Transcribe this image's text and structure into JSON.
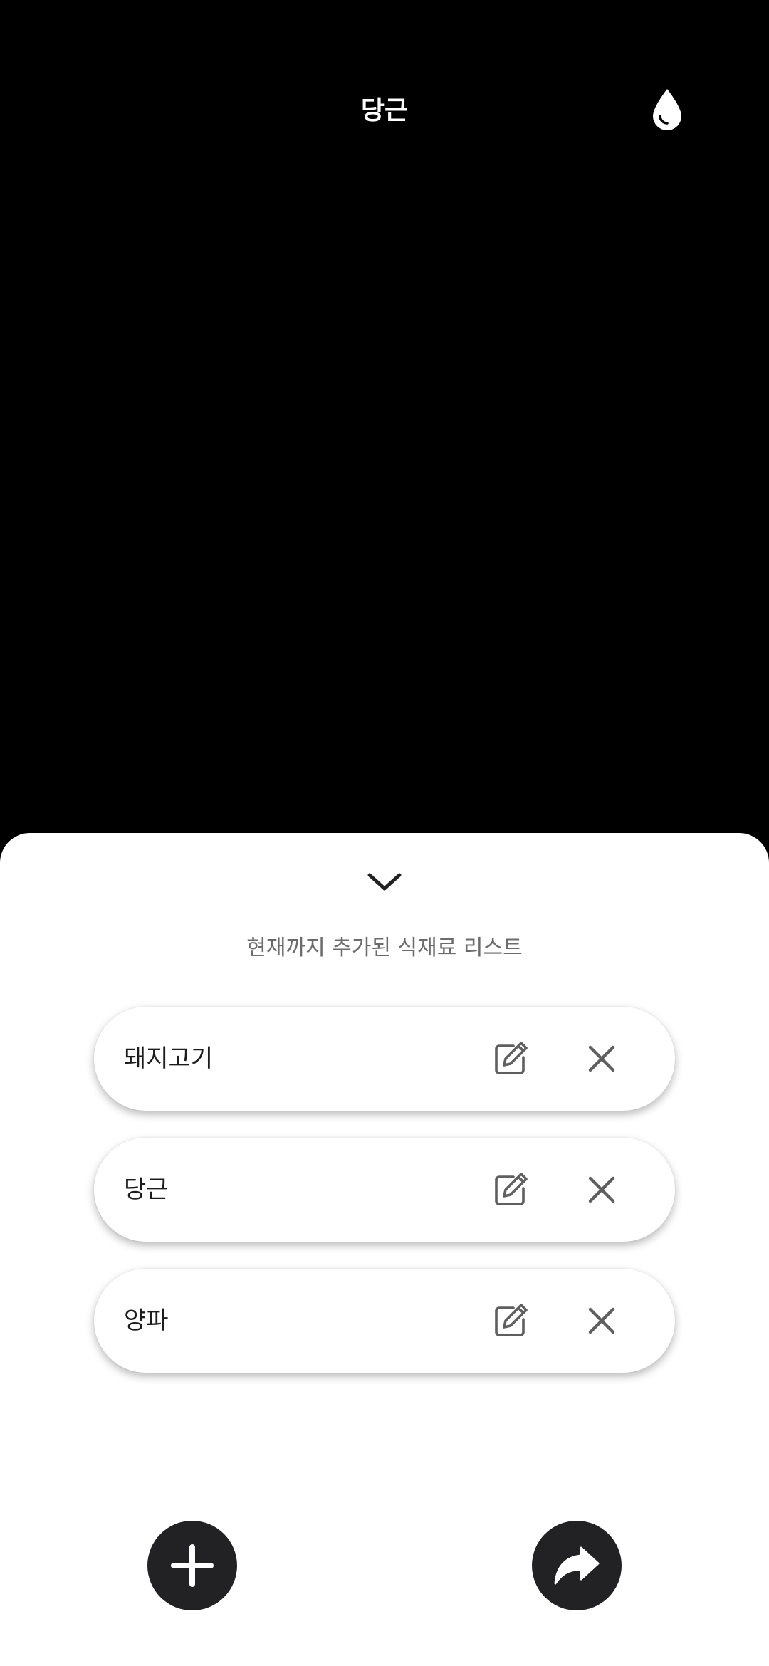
{
  "header": {
    "title": "당근",
    "drop_icon": "water-drop-icon"
  },
  "sheet": {
    "collapse_icon": "chevron-down-icon",
    "subtitle": "현재까지 추가된 식재료 리스트",
    "items": [
      {
        "label": "돼지고기"
      },
      {
        "label": "당근"
      },
      {
        "label": "양파"
      }
    ],
    "edit_icon": "edit-icon",
    "delete_icon": "close-icon"
  },
  "actions": {
    "add_icon": "plus-icon",
    "share_icon": "share-arrow-icon"
  },
  "colors": {
    "background": "#000000",
    "sheet": "#ffffff",
    "fab": "#222224",
    "icon_gray": "#5f5f5f",
    "subtitle": "#6b6b6b"
  }
}
